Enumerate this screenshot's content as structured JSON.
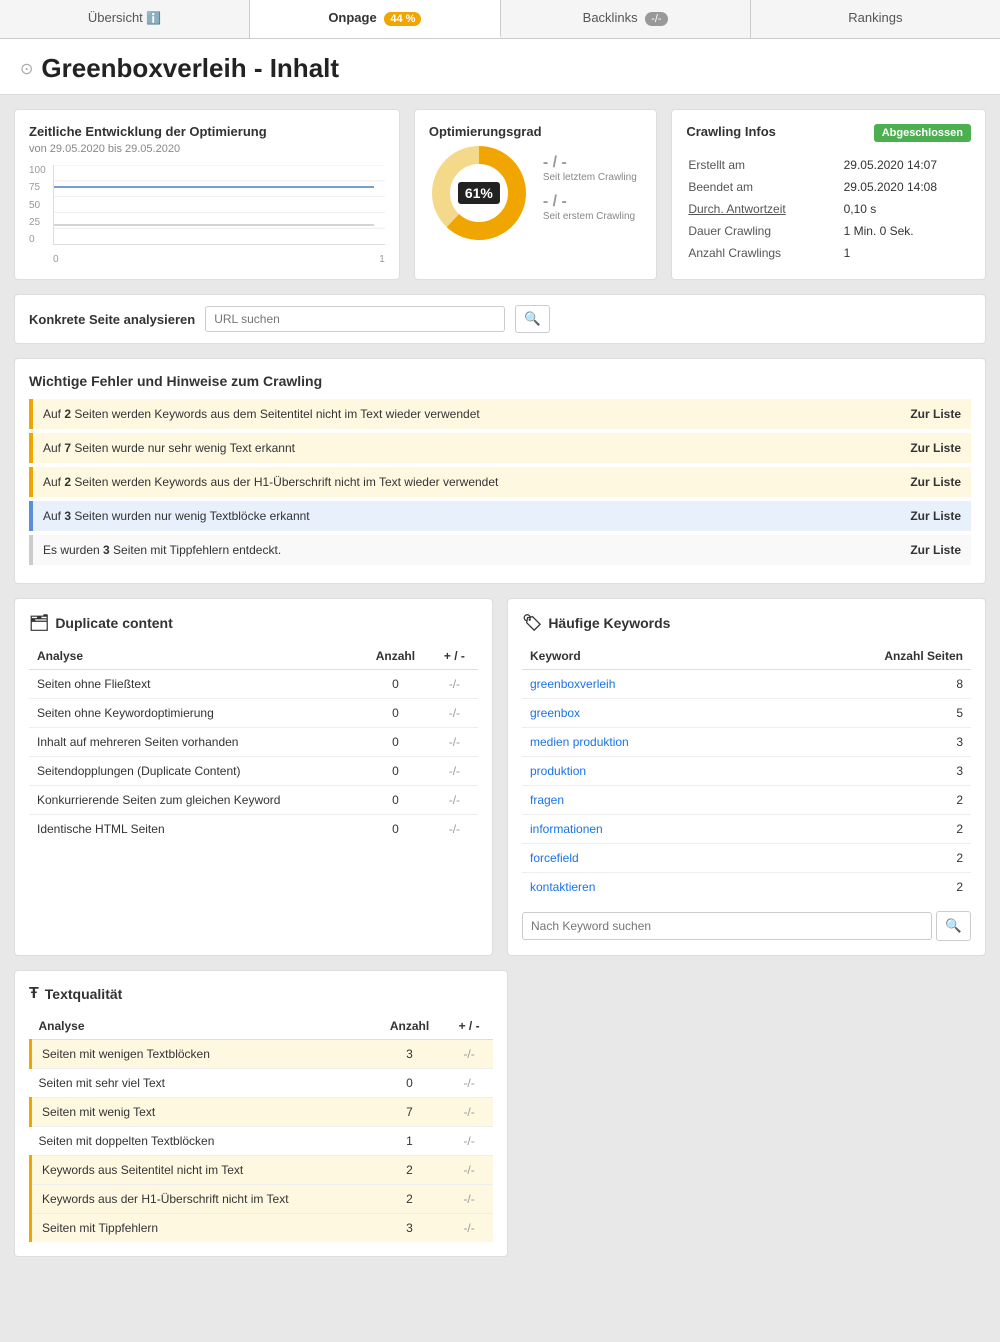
{
  "tabs": [
    {
      "label": "Übersicht",
      "icon": "ℹ",
      "badge": null,
      "badge_type": null,
      "active": false
    },
    {
      "label": "Onpage",
      "badge": "44 %",
      "badge_type": "orange",
      "active": true
    },
    {
      "label": "Backlinks",
      "badge": "-/-",
      "badge_type": "gray",
      "active": false
    },
    {
      "label": "Rankings",
      "badge": null,
      "active": false
    }
  ],
  "page_title": "Greenboxverleih - Inhalt",
  "chart_section": {
    "title": "Zeitliche Entwicklung der Optimierung",
    "subtitle": "von 29.05.2020 bis 29.05.2020",
    "y_labels": [
      "100",
      "75",
      "50",
      "25",
      "0"
    ],
    "x_labels": [
      "0",
      "1"
    ]
  },
  "optimization": {
    "title": "Optimierungsgrad",
    "percent": "61%",
    "stat1_value": "- / -",
    "stat1_label": "Seit letztem Crawling",
    "stat2_value": "- / -",
    "stat2_label": "Seit erstem Crawling"
  },
  "crawling": {
    "title": "Crawling Infos",
    "status": "Abgeschlossen",
    "rows": [
      {
        "label": "Erstellt am",
        "value": "29.05.2020 14:07"
      },
      {
        "label": "Beendet am",
        "value": "29.05.2020 14:08"
      },
      {
        "label": "Durch. Antwortzeit",
        "value": "0,10 s",
        "underline": true
      },
      {
        "label": "Dauer Crawling",
        "value": "1 Min. 0 Sek."
      },
      {
        "label": "Anzahl Crawlings",
        "value": "1"
      }
    ]
  },
  "url_search": {
    "label": "Konkrete Seite analysieren",
    "placeholder": "URL suchen"
  },
  "errors": {
    "title": "Wichtige Fehler und Hinweise zum Crawling",
    "items": [
      {
        "text": "Auf <b>2</b> Seiten werden Keywords aus dem Seitentitel nicht im Text wieder verwendet",
        "type": "orange",
        "action": "Zur Liste"
      },
      {
        "text": "Auf <b>7</b> Seiten wurde nur sehr wenig Text erkannt",
        "type": "orange",
        "action": "Zur Liste"
      },
      {
        "text": "Auf <b>2</b> Seiten werden Keywords aus der H1-Überschrift nicht im Text wieder verwendet",
        "type": "orange",
        "action": "Zur Liste"
      },
      {
        "text": "Auf <b>3</b> Seiten wurden nur wenig Textblöcke erkannt",
        "type": "blue",
        "action": "Zur Liste"
      },
      {
        "text": "Es wurden <b>3</b> Seiten mit Tippfehlern entdeckt.",
        "type": "plain",
        "action": "Zur Liste"
      }
    ]
  },
  "duplicate": {
    "title": "Duplicate content",
    "columns": [
      "Analyse",
      "Anzahl",
      "+ / -"
    ],
    "rows": [
      {
        "analyse": "Seiten ohne Fließtext",
        "anzahl": "0",
        "delta": "-/-"
      },
      {
        "analyse": "Seiten ohne Keywordoptimierung",
        "anzahl": "0",
        "delta": "-/-"
      },
      {
        "analyse": "Inhalt auf mehreren Seiten vorhanden",
        "anzahl": "0",
        "delta": "-/-"
      },
      {
        "analyse": "Seitendopplungen (Duplicate Content)",
        "anzahl": "0",
        "delta": "-/-"
      },
      {
        "analyse": "Konkurrierende Seiten zum gleichen Keyword",
        "anzahl": "0",
        "delta": "-/-"
      },
      {
        "analyse": "Identische HTML Seiten",
        "anzahl": "0",
        "delta": "-/-"
      }
    ]
  },
  "keywords": {
    "title": "Häufige Keywords",
    "columns": [
      "Keyword",
      "Anzahl Seiten"
    ],
    "rows": [
      {
        "keyword": "greenboxverleih",
        "count": "8"
      },
      {
        "keyword": "greenbox",
        "count": "5"
      },
      {
        "keyword": "medien produktion",
        "count": "3"
      },
      {
        "keyword": "produktion",
        "count": "3"
      },
      {
        "keyword": "fragen",
        "count": "2"
      },
      {
        "keyword": "informationen",
        "count": "2"
      },
      {
        "keyword": "forcefield",
        "count": "2"
      },
      {
        "keyword": "kontaktieren",
        "count": "2"
      }
    ],
    "search_placeholder": "Nach Keyword suchen"
  },
  "textquality": {
    "title": "Textqualität",
    "columns": [
      "Analyse",
      "Anzahl",
      "+ / -"
    ],
    "rows": [
      {
        "analyse": "Seiten mit wenigen Textblöcken",
        "anzahl": "3",
        "delta": "-/-",
        "highlight": true
      },
      {
        "analyse": "Seiten mit sehr viel Text",
        "anzahl": "0",
        "delta": "-/-",
        "highlight": false
      },
      {
        "analyse": "Seiten mit wenig Text",
        "anzahl": "7",
        "delta": "-/-",
        "highlight": true
      },
      {
        "analyse": "Seiten mit doppelten Textblöcken",
        "anzahl": "1",
        "delta": "-/-",
        "highlight": false
      },
      {
        "analyse": "Keywords aus Seitentitel nicht im Text",
        "anzahl": "2",
        "delta": "-/-",
        "highlight": true
      },
      {
        "analyse": "Keywords aus der H1-Überschrift nicht im Text",
        "anzahl": "2",
        "delta": "-/-",
        "highlight": true
      },
      {
        "analyse": "Seiten mit Tippfehlern",
        "anzahl": "3",
        "delta": "-/-",
        "highlight": true
      }
    ]
  }
}
